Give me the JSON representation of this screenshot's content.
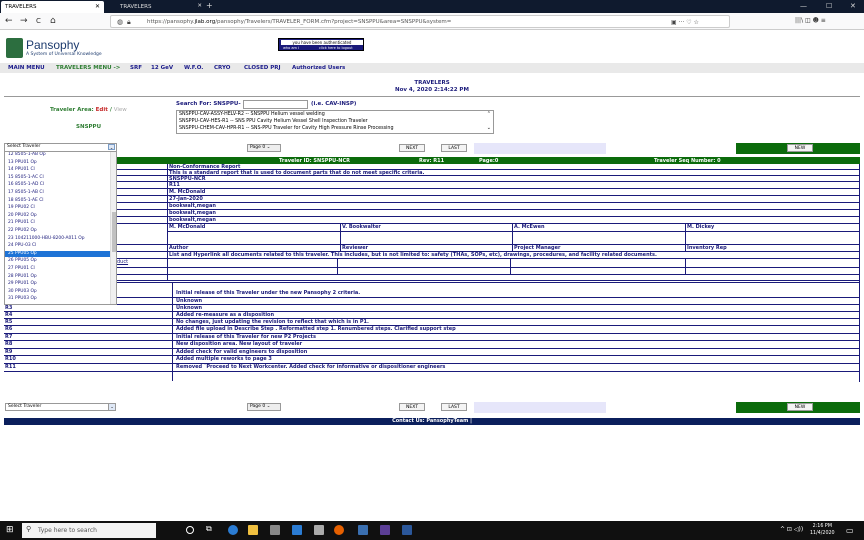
{
  "browser": {
    "tabs": [
      {
        "label": "TRAVELERS",
        "close": "✕"
      },
      {
        "label": "TRAVELERS",
        "close": "✕"
      }
    ],
    "new_tab": "+",
    "window_controls": [
      "—",
      "☐",
      "✕"
    ],
    "url_prefix": "https://pansophy.",
    "url_domain": "jlab.org",
    "url_rest": "/pansophy/Travelers/TRAVELER_FORM.cfm?project=SNSPPU&area=SNSPPU&system=",
    "nav": {
      "back": "←",
      "forward": "→",
      "reload": "C",
      "home": "⌂"
    },
    "url_right_icons": "▣   ···  ♡  ☆",
    "toolbar_right": "|||\\  ◫  ☻  ≡"
  },
  "app": {
    "logo_name": "Pansophy",
    "logo_tagline": "A System of Universal Knowledge",
    "auth_text": "you have been authenticated",
    "who_am_i": "who am i",
    "logout": "click here to logout"
  },
  "menu": [
    {
      "label": "MAIN MENU"
    },
    {
      "label": "TRAVELERS MENU ->"
    },
    {
      "label": "SRF"
    },
    {
      "label": "12 GeV"
    },
    {
      "label": "W.F.O."
    },
    {
      "label": "CRYO"
    },
    {
      "label": "CLOSED PRJ"
    },
    {
      "label": "Authorized Users"
    }
  ],
  "header": {
    "title": "TRAVELERS",
    "datetime": "Nov 4, 2020 2:14:22 PM"
  },
  "area": {
    "label": "Traveler Area:",
    "edit": "Edit",
    "sep": "/",
    "view": "View",
    "name": "SNSPPU"
  },
  "search": {
    "label": "Search For: SNSPPU-",
    "value": "",
    "hint": "(i.e. CAV-INSP)",
    "options": [
      "SNSPPU-CAV-ASSY-HELV-R2 -- SNSPPU Helium vessel welding",
      "SNSPPU-CAV-HES-R1 -- SNS PPU Cavity Helium Vessel Shell Inspection Traveler",
      "SNSPPU-CHEM-CAV-HPR-R1 -- SNS-PPU Traveler for Cavity High Pressure Rinse Processing"
    ]
  },
  "controls": {
    "select_traveler": "Select Traveler",
    "page": "Page 0",
    "next": "NEXT",
    "last": "LAST",
    "new": "NEW"
  },
  "dropdown": {
    "header": "Select Traveler",
    "items": [
      "12  8505-1-AB   Op",
      "13  PPU01   Op",
      "14  PPU01   Cl",
      "15  8505-1-AC   Cl",
      "16  8505-1-AD   Cl",
      "17  8505-1-AB   Cl",
      "18  8505-1-AE   Cl",
      "19  PPU02   Cl",
      "20  PPU02   Op",
      "21  PPU01   Cl",
      "22  PPU02   Op",
      "23  104211000-HBU-8200-A011   Op",
      "24  PPU-03   Cl",
      "25  PPU05   Op",
      "26  PPU05   Op",
      "27  PPU01   Cl",
      "28  PPU01   Op",
      "29  PPU01   Op",
      "30  PPU03   Op",
      "31  PPU03   Op"
    ],
    "selected_index": 13
  },
  "traveler": {
    "id": "Traveler ID: SNSPPU-NCR",
    "rev": "Rev: R11",
    "page": "Page:0",
    "seq": "Traveler Seq Number: 0",
    "fields": [
      "Non-Conformance Report",
      "This is a standard report that is used to document parts that do not meet specific criteria.",
      "SNSPPU-NCR",
      "R11",
      "M. McDonald",
      "27-Jan-2020",
      "bookwalt,megan",
      "bookwalt,megan",
      "bookwalt,megan"
    ],
    "signers": [
      "M. McDonald",
      "V. Bookwalter",
      "A. McEwen",
      "M. Dickey"
    ],
    "roles": [
      "Author",
      "Reviewer",
      "Project Manager",
      "Inventory Rep"
    ],
    "docs_note": "List and Hyperlink all documents related to this traveler. This includes, but is not limited to: safety (THAs, SOPs, etc), drawings, procedures, and facility related documents.",
    "docs_left": "duct",
    "revisions": [
      {
        "rev": "R1",
        "text": "Initial release of this Traveler under the new Pansophy 2 criteria."
      },
      {
        "rev": "R2",
        "text": "Unknown"
      },
      {
        "rev": "R3",
        "text": "Unknown"
      },
      {
        "rev": "R4",
        "text": "Added re-measure as a disposition"
      },
      {
        "rev": "R5",
        "text": "No changes, just updating the revision to reflect that which is in P1."
      },
      {
        "rev": "R6",
        "text": "Added file upload in Describe Step . Reformatted step 1. Renumbered steps. Clarified support step"
      },
      {
        "rev": "R7",
        "text": "Initial release of this Traveler for new P2 Projects"
      },
      {
        "rev": "R8",
        "text": "New disposition area. New layout of traveler"
      },
      {
        "rev": "R9",
        "text": "Added check for valid engineers to disposition"
      },
      {
        "rev": "R10",
        "text": "Added multiple reworks to page 3"
      },
      {
        "rev": "R11",
        "text": "Removed `Proceed to Next Workcenter. Added check for informative or dispositioner engineers"
      }
    ]
  },
  "footer": {
    "contact": "Contact Us: PansophyTeam |"
  },
  "taskbar": {
    "search_placeholder": "Type here to search",
    "time": "2:16 PM",
    "date": "11/4/2020",
    "tray": "^  ⊡  ◁))"
  },
  "colors": {
    "green": "#0b6b0b",
    "navy": "#1a1a7a",
    "lavender": "#e6e6fa",
    "selected": "#1e73d6"
  }
}
